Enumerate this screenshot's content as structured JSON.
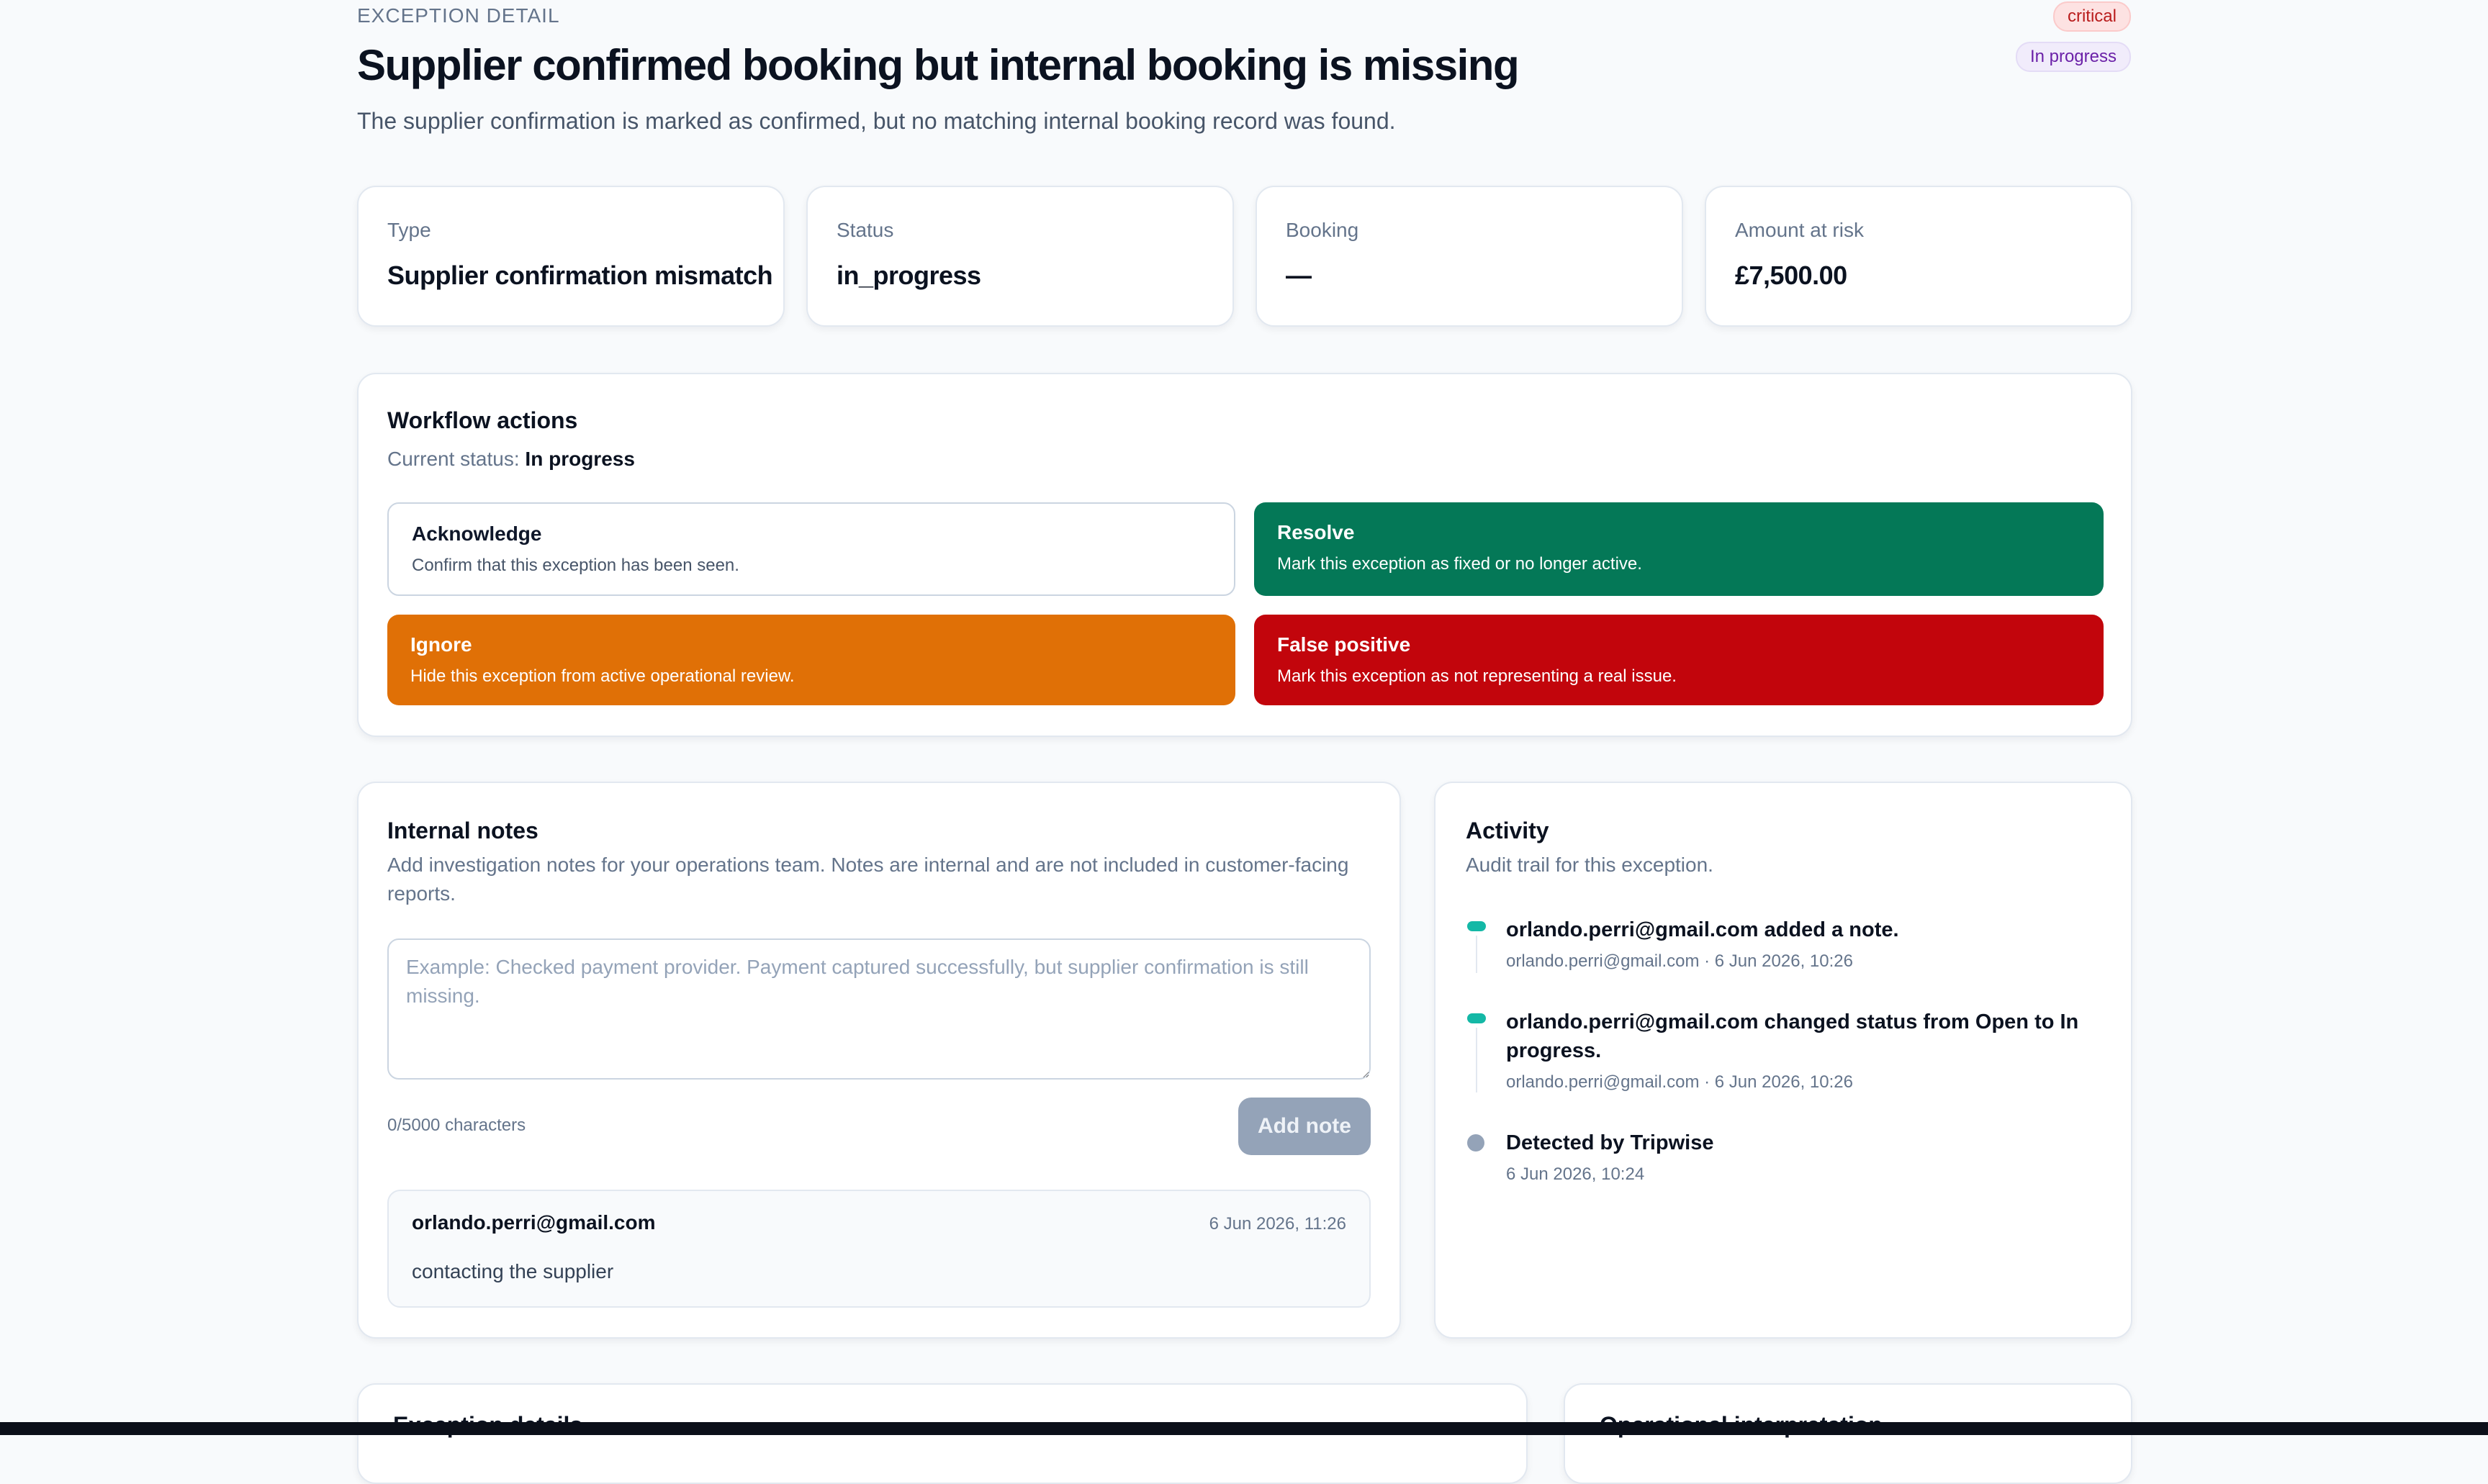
{
  "header": {
    "eyebrow": "EXCEPTION DETAIL",
    "severity_badge": "critical",
    "status_badge": "In progress",
    "title": "Supplier confirmed booking but internal booking is missing",
    "subtitle": "The supplier confirmation is marked as confirmed, but no matching internal booking record was found."
  },
  "kpis": [
    {
      "label": "Type",
      "value": "Supplier confirmation mismatch"
    },
    {
      "label": "Status",
      "value": "in_progress"
    },
    {
      "label": "Booking",
      "value": "—"
    },
    {
      "label": "Amount at risk",
      "value": "£7,500.00"
    }
  ],
  "workflow": {
    "title": "Workflow actions",
    "current_status_label": "Current status:",
    "current_status_value": "In progress",
    "actions": [
      {
        "title": "Acknowledge",
        "description": "Confirm that this exception has been seen."
      },
      {
        "title": "Resolve",
        "description": "Mark this exception as fixed or no longer active."
      },
      {
        "title": "Ignore",
        "description": "Hide this exception from active operational review."
      },
      {
        "title": "False positive",
        "description": "Mark this exception as not representing a real issue."
      }
    ]
  },
  "notes": {
    "title": "Internal notes",
    "description": "Add investigation notes for your operations team. Notes are internal and are not included in customer-facing reports.",
    "placeholder": "Example: Checked payment provider. Payment captured successfully, but supplier confirmation is still missing.",
    "char_count": "0/5000 characters",
    "add_button": "Add note",
    "items": [
      {
        "author": "orlando.perri@gmail.com",
        "timestamp": "6 Jun 2026, 11:26",
        "text": "contacting the supplier"
      }
    ]
  },
  "activity": {
    "title": "Activity",
    "subtitle": "Audit trail for this exception.",
    "items": [
      {
        "title": "orlando.perri@gmail.com added a note.",
        "meta": "orlando.perri@gmail.com · 6 Jun 2026, 10:26"
      },
      {
        "title": "orlando.perri@gmail.com changed status from Open to In progress.",
        "meta": "orlando.perri@gmail.com · 6 Jun 2026, 10:26"
      },
      {
        "title": "Detected by Tripwise",
        "meta": "6 Jun 2026, 10:24"
      }
    ]
  },
  "bottom_sections": {
    "details_title": "Exception details",
    "interpretation_title": "Operational interpretation"
  },
  "colors": {
    "resolve": "#047857",
    "ignore": "#e07006",
    "false_positive": "#c2050c",
    "timeline_accent": "#14b8a6",
    "timeline_muted": "#94a3b8"
  }
}
